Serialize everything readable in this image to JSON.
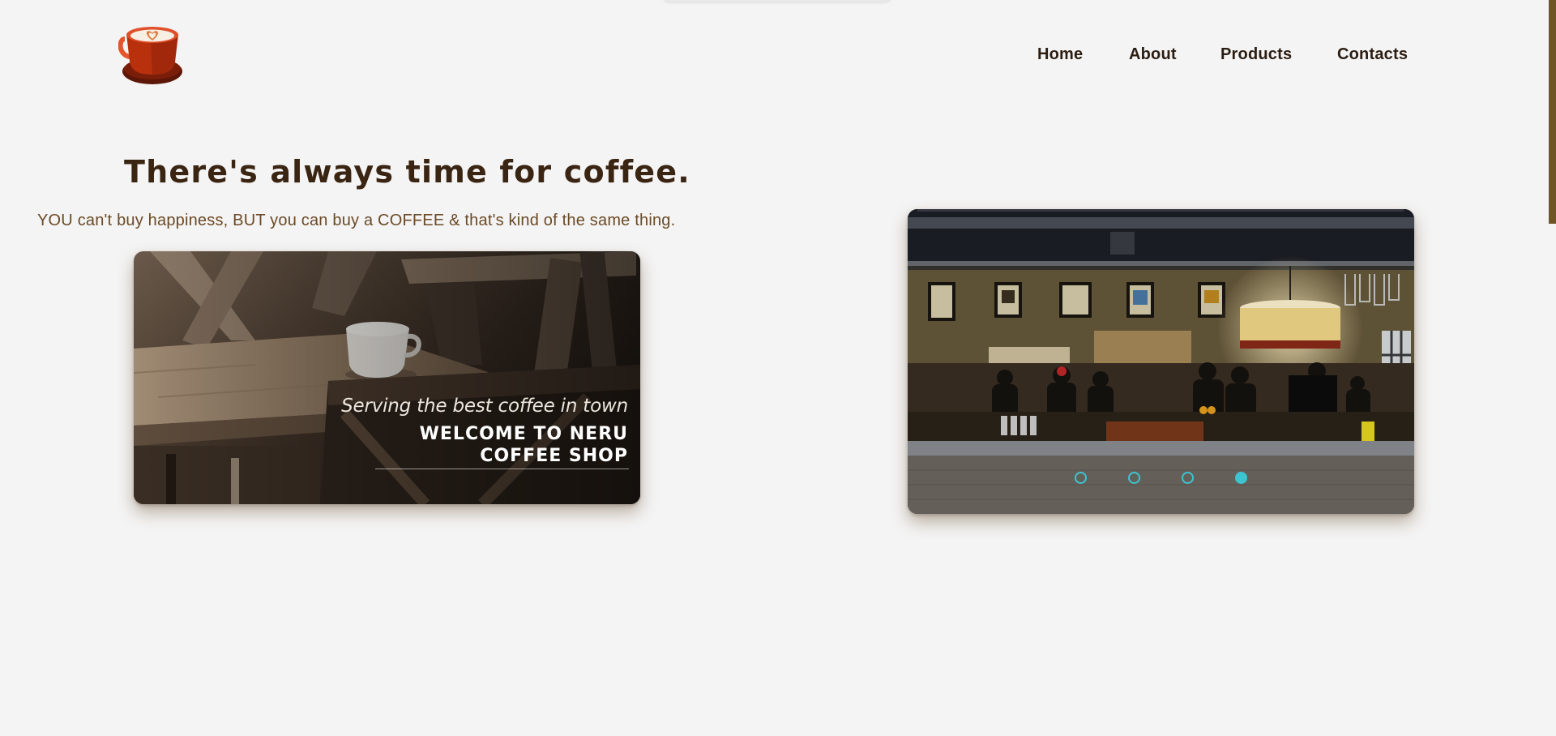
{
  "brand": {
    "logo_icon": "coffee-cup-logo-icon"
  },
  "nav": {
    "items": [
      {
        "label": "Home"
      },
      {
        "label": "About"
      },
      {
        "label": "Products"
      },
      {
        "label": "Contacts"
      }
    ]
  },
  "hero": {
    "title": "There's always time for coffee.",
    "tagline": "YOU can't buy happiness, BUT you can buy a COFFEE & that's kind of the same thing."
  },
  "promo_card": {
    "subtitle": "Serving the best coffee in town",
    "headline": "WELCOME TO NERU COFFEE SHOP"
  },
  "carousel": {
    "slide_count": 4,
    "active_index": 3,
    "indicator_color": "#3cc4d0"
  },
  "colors": {
    "background": "#f4f4f4",
    "heading": "#3a2412",
    "tagline": "#6b4a26",
    "scrollbar": "#6f5426"
  }
}
